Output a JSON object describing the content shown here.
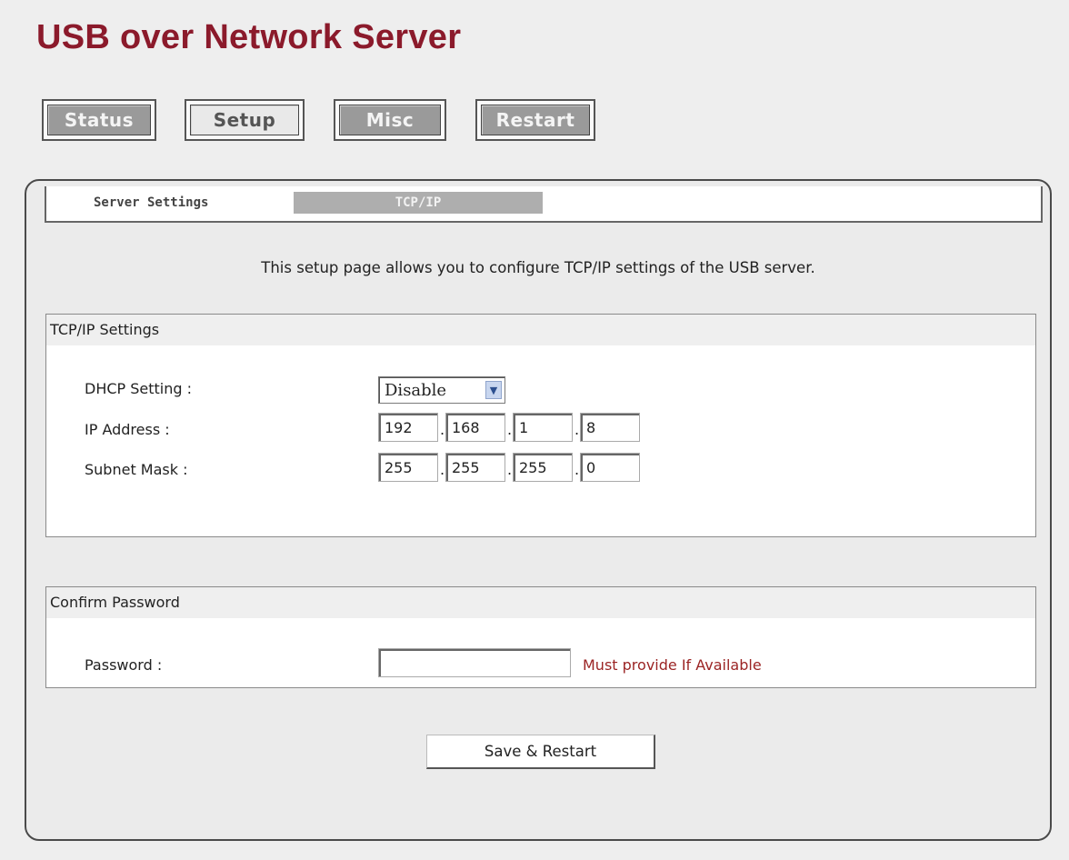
{
  "app": {
    "title": "USB over Network Server"
  },
  "nav": {
    "buttons": [
      {
        "label": "Status",
        "active": false
      },
      {
        "label": "Setup",
        "active": true
      },
      {
        "label": "Misc",
        "active": false
      },
      {
        "label": "Restart",
        "active": false
      }
    ]
  },
  "subtabs": {
    "server_settings": "Server Settings",
    "tcpip": "TCP/IP"
  },
  "intro": "This setup page allows you to configure TCP/IP settings of the USB server.",
  "tcpip_settings": {
    "heading": "TCP/IP Settings",
    "dhcp": {
      "label": "DHCP Setting :",
      "value": "Disable"
    },
    "ip_address": {
      "label": "IP Address :",
      "octets": [
        "192",
        "168",
        "1",
        "8"
      ]
    },
    "subnet_mask": {
      "label": "Subnet Mask :",
      "octets": [
        "255",
        "255",
        "255",
        "0"
      ]
    },
    "separator": "."
  },
  "confirm_password": {
    "heading": "Confirm Password",
    "label": "Password :",
    "value": "",
    "note": "Must provide If Available"
  },
  "actions": {
    "save_label": "Save & Restart"
  },
  "colors": {
    "title": "#8b1a2b",
    "note": "#9b2424",
    "tab_active_bg": "#aeaeae",
    "nav_button_bg": "#9a9a9a"
  },
  "icons": {
    "dropdown": "chevron-down-icon"
  }
}
